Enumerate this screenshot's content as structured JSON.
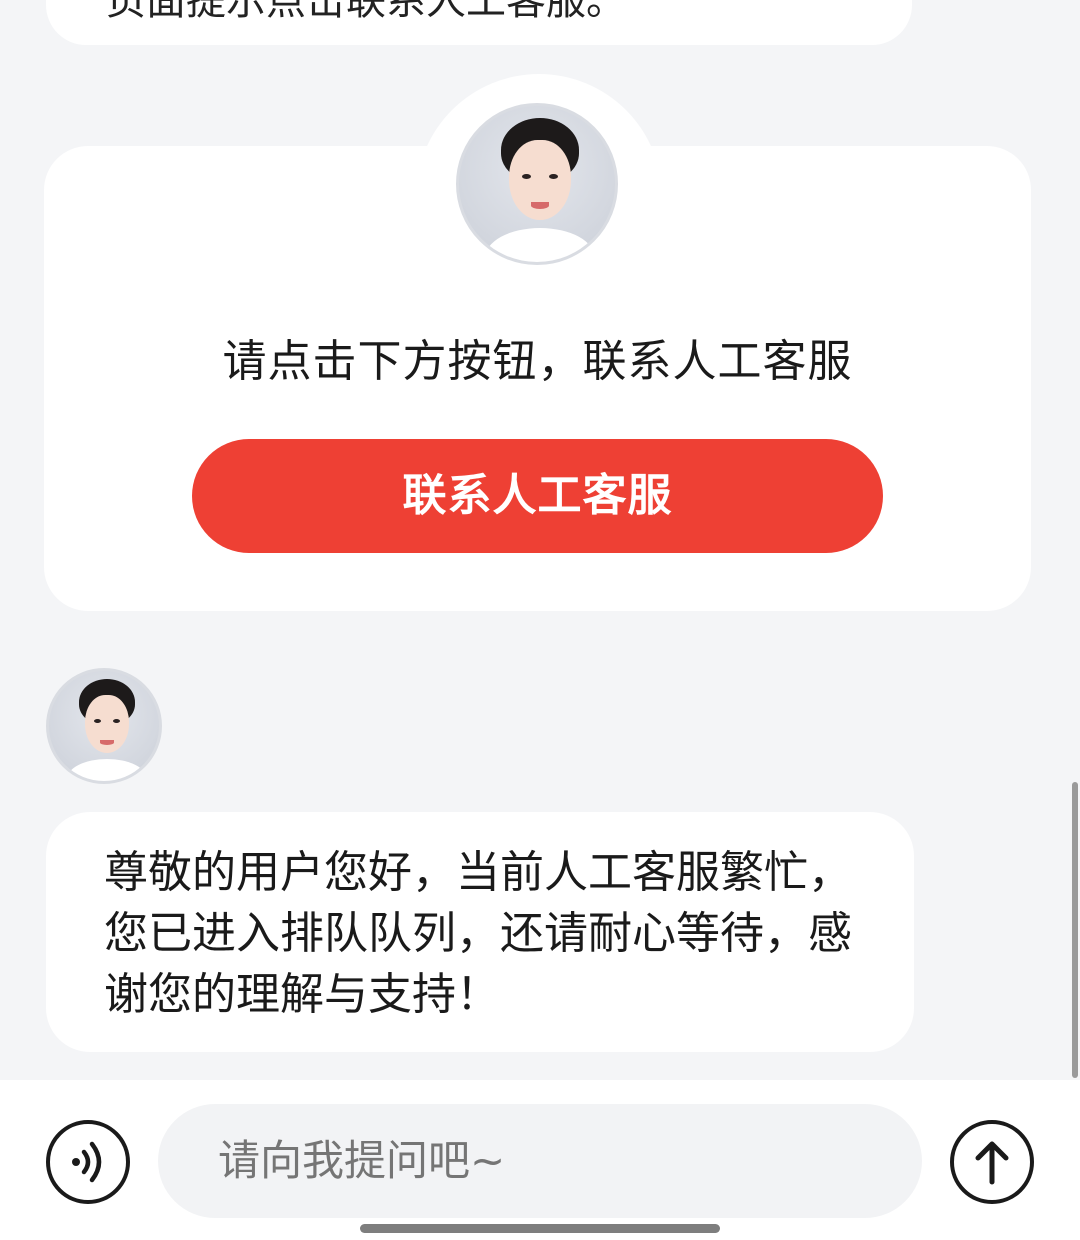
{
  "previous_message": {
    "text": "页面提示点击联系人工客服。"
  },
  "contact_card": {
    "prompt": "请点击下方按钮，联系人工客服",
    "button_label": "联系人工客服"
  },
  "agent_message": {
    "text": "尊敬的用户您好，当前人工客服繁忙，您已进入排队队列，还请耐心等待，感谢您的理解与支持！"
  },
  "composer": {
    "placeholder": "请向我提问吧~",
    "voice_icon": "voice-icon",
    "send_icon": "arrow-up-icon"
  },
  "colors": {
    "accent": "#ee4034",
    "background": "#f4f5f7",
    "bubble": "#ffffff"
  }
}
